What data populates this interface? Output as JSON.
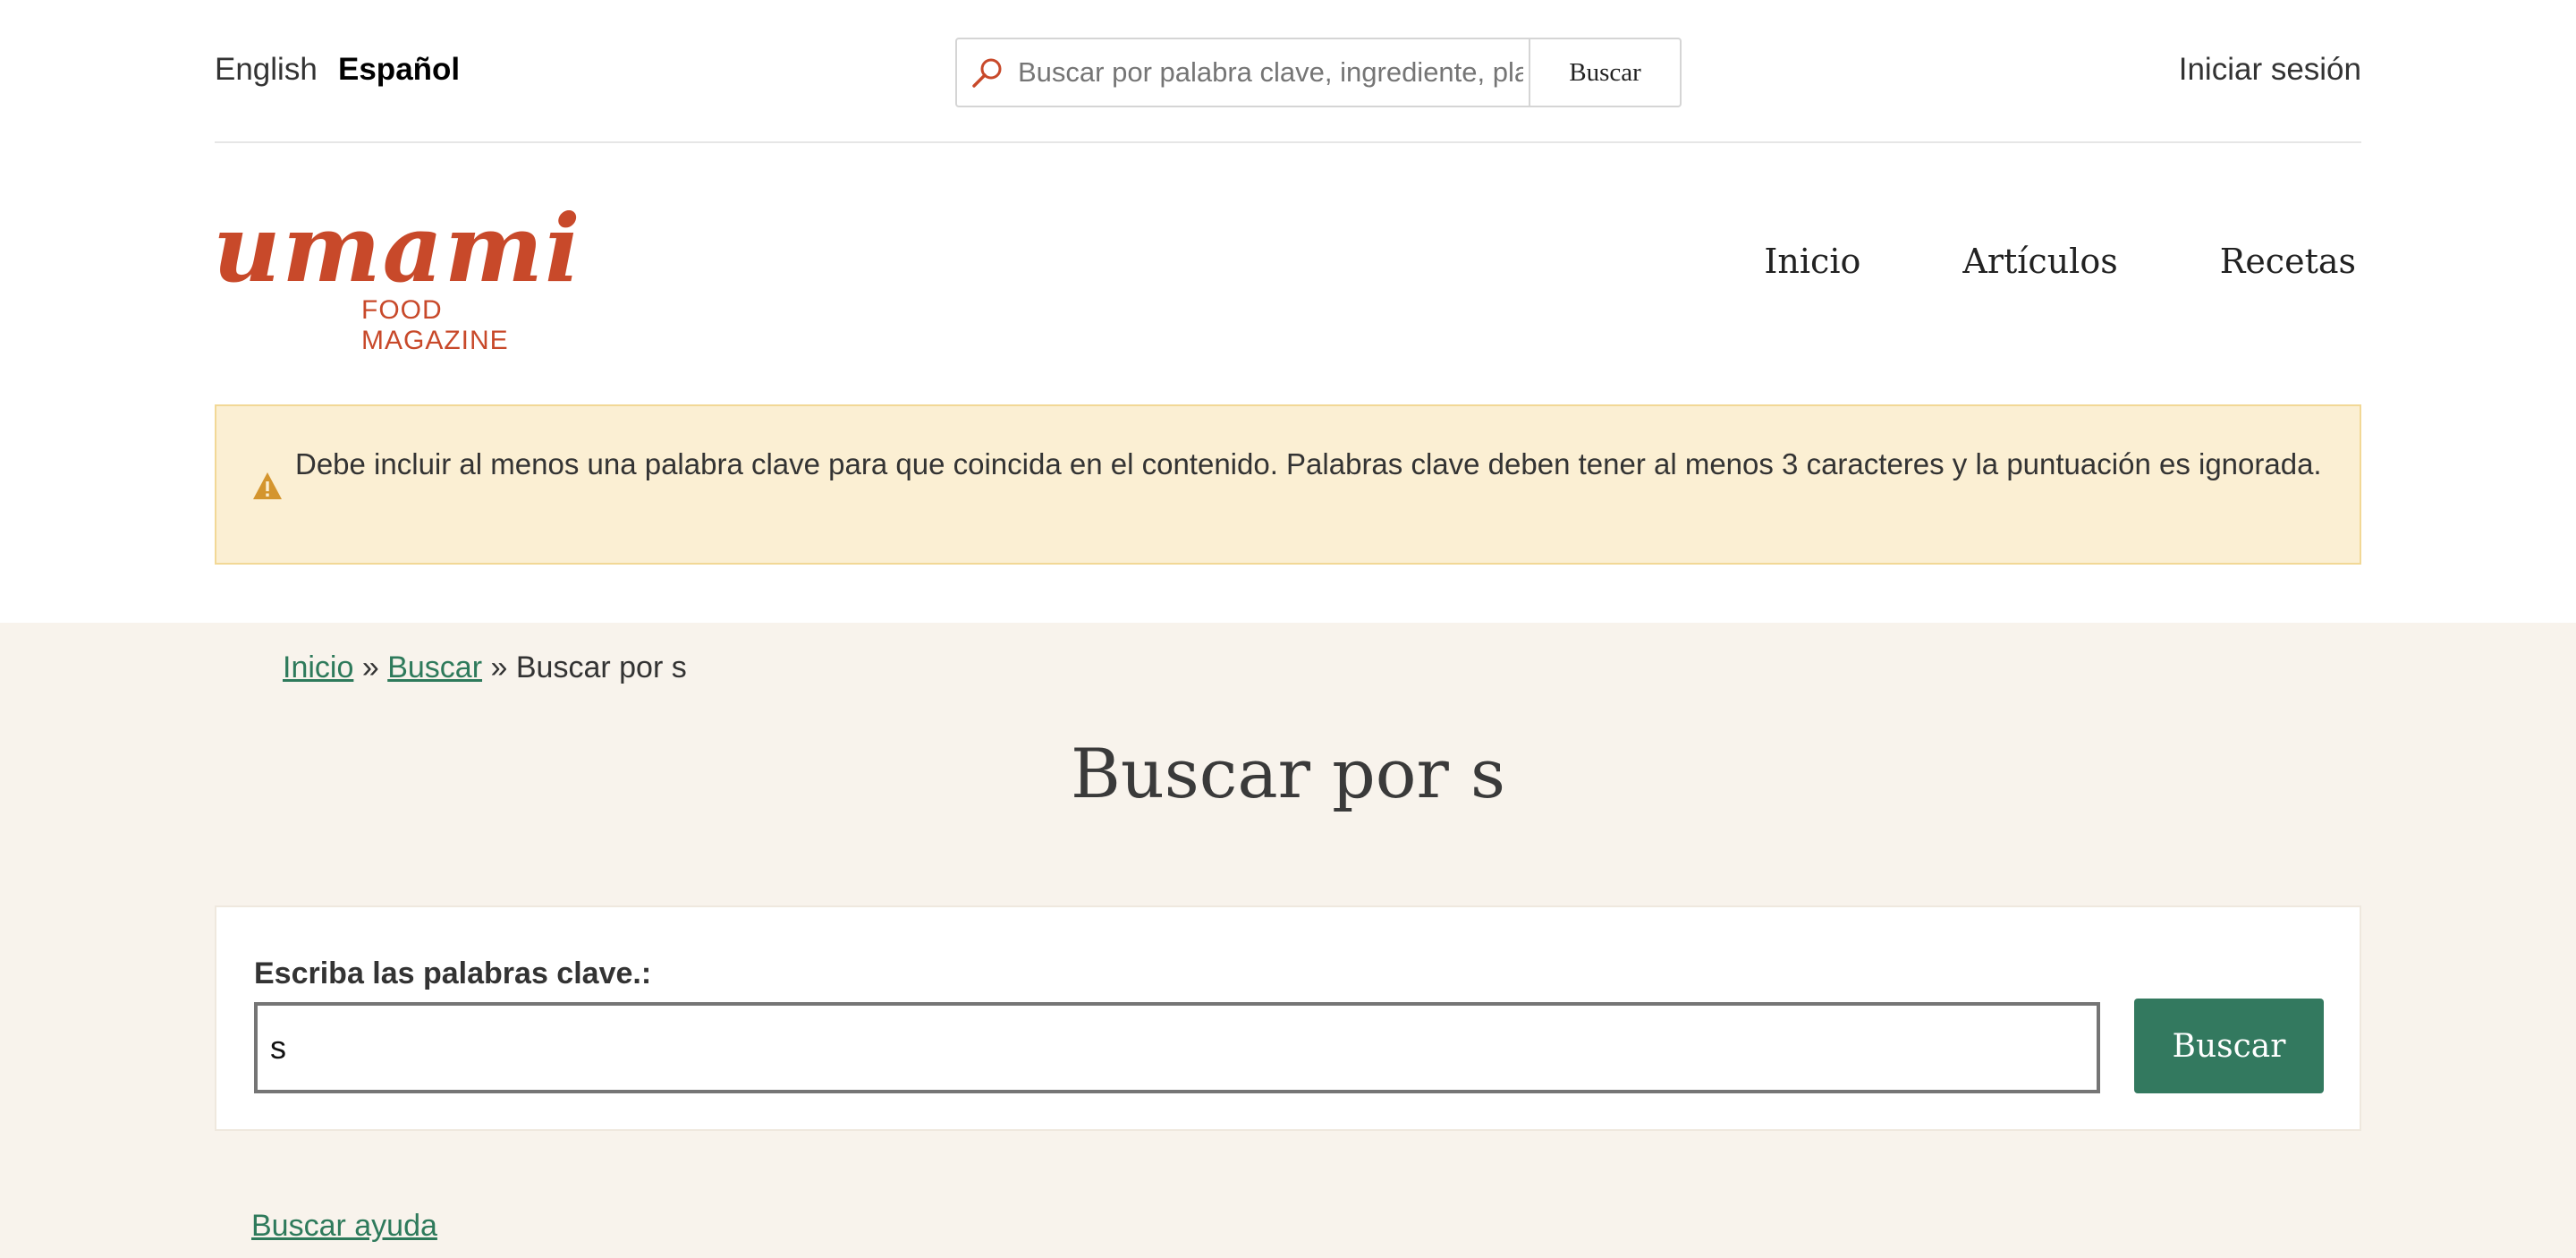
{
  "language_switcher": {
    "english": "English",
    "spanish": "Español"
  },
  "top_search": {
    "placeholder": "Buscar por palabra clave, ingrediente, plato",
    "button_label": "Buscar"
  },
  "account": {
    "login_label": "Iniciar sesión"
  },
  "logo": {
    "wordmark": "umami",
    "subtitle": "FOOD MAGAZINE"
  },
  "main_nav": [
    "Inicio",
    "Artículos",
    "Recetas"
  ],
  "warning": {
    "icon": "warning-triangle-icon",
    "message": "Debe incluir al menos una palabra clave para que coincida en el contenido. Palabras clave deben tener al menos 3 caracteres y la puntuación es ignorada."
  },
  "breadcrumb": {
    "home": "Inicio",
    "separator": "»",
    "search": "Buscar",
    "current": "Buscar por s"
  },
  "page_title": "Buscar por s",
  "search_form": {
    "label": "Escriba las palabras clave.:",
    "value": "s",
    "button_label": "Buscar"
  },
  "help_link": "Buscar ayuda",
  "colors": {
    "brand": "#c8492a",
    "accent_green": "#33795f",
    "link_green": "#2e7a5b",
    "warning_bg": "#fbefd3",
    "band_bg": "#f8f3ec"
  }
}
